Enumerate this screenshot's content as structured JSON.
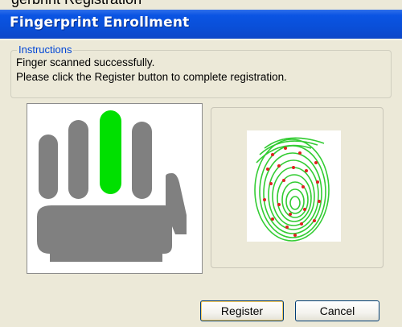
{
  "window": {
    "title": "Fingerprint Enrollment",
    "cropped_title_above": "gerbrint Registration"
  },
  "instructions": {
    "legend": "Instructions",
    "line1": "Finger scanned successfully.",
    "line2": "Please click the Register button to complete registration."
  },
  "hand": {
    "selected_finger": "middle",
    "finger_color": "#808080",
    "selected_color": "#00E000"
  },
  "fingerprint": {
    "ridge_color": "#33CC33",
    "minutiae_color": "#E02020"
  },
  "buttons": {
    "register_label": "Register",
    "cancel_label": "Cancel"
  }
}
